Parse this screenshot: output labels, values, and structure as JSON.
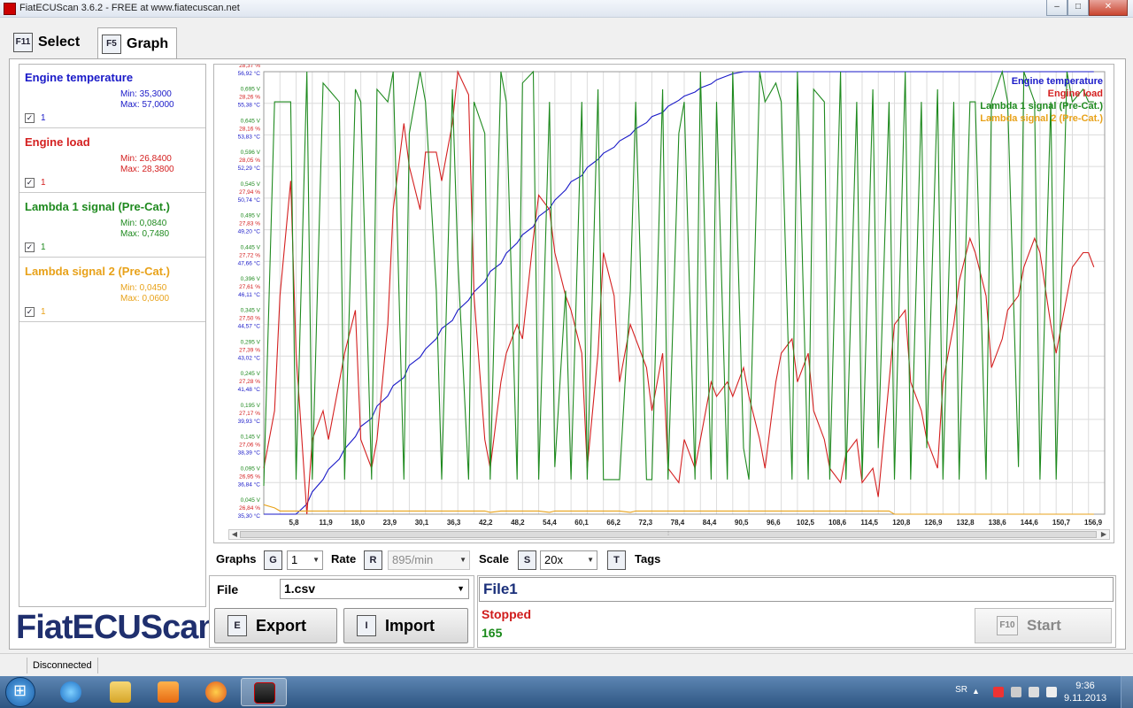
{
  "window": {
    "title": "FiatECUScan 3.6.2 - FREE at www.fiatecuscan.net"
  },
  "tabs": [
    {
      "key": "F11",
      "label": "Select"
    },
    {
      "key": "F5",
      "label": "Graph"
    }
  ],
  "signals": [
    {
      "name": "Engine temperature",
      "min": "Min: 35,3000",
      "max": "Max: 57,0000",
      "check_label": "1",
      "color": "#1a1ac8"
    },
    {
      "name": "Engine load",
      "min": "Min: 26,8400",
      "max": "Max: 28,3800",
      "check_label": "1",
      "color": "#d42020"
    },
    {
      "name": "Lambda 1 signal (Pre-Cat.)",
      "min": "Min: 0,0840",
      "max": "Max: 0,7480",
      "check_label": "1",
      "color": "#1f8a1f"
    },
    {
      "name": "Lambda signal 2 (Pre-Cat.)",
      "min": "Min: 0,0450",
      "max": "Max: 0,0600",
      "check_label": "1",
      "color": "#e8a21a"
    }
  ],
  "logo": "FiatECUScan",
  "controls": {
    "graphs_label": "Graphs",
    "graphs_key": "G",
    "graphs_value": "1",
    "rate_label": "Rate",
    "rate_key": "R",
    "rate_value": "895/min",
    "scale_label": "Scale",
    "scale_key": "S",
    "scale_value": "20x",
    "tags_label": "Tags",
    "tags_key": "T"
  },
  "file": {
    "label": "File",
    "value": "1.csv",
    "export_key": "E",
    "export_label": "Export",
    "import_key": "I",
    "import_label": "Import"
  },
  "session": {
    "name": "File1",
    "status": "Stopped",
    "count": "165",
    "start_key": "F10",
    "start_label": "Start"
  },
  "statusbar": {
    "connection": "Disconnected"
  },
  "taskbar": {
    "language": "SR",
    "time": "9:36",
    "date": "9.11.2013"
  },
  "chart_data": {
    "type": "line",
    "x_ticks": [
      "5,8",
      "11,9",
      "18,0",
      "23,9",
      "30,1",
      "36,3",
      "42,2",
      "48,2",
      "54,4",
      "60,1",
      "66,2",
      "72,3",
      "78,4",
      "84,4",
      "90,5",
      "96,6",
      "102,5",
      "108,6",
      "114,5",
      "120,8",
      "126,9",
      "132,8",
      "138,6",
      "144,6",
      "150,7",
      "156,9"
    ],
    "x": [
      3,
      5,
      6,
      8,
      9,
      11,
      12,
      14,
      15,
      17,
      18,
      20,
      21,
      23,
      24,
      26,
      27,
      29,
      30,
      32,
      33,
      35,
      36,
      38,
      39,
      41,
      42,
      44,
      45,
      47,
      48,
      50,
      51,
      53,
      54,
      56,
      57,
      59,
      60,
      62,
      63,
      65,
      66,
      68,
      69,
      71,
      72,
      74,
      75,
      77,
      78,
      80,
      81,
      83,
      84,
      86,
      87,
      89,
      90,
      92,
      93,
      95,
      96,
      98,
      99,
      101,
      102,
      104,
      105,
      107,
      108,
      110,
      111,
      113,
      114,
      116,
      117,
      119,
      120,
      122,
      123,
      125,
      126,
      128,
      129,
      131,
      132,
      134,
      135,
      137,
      138,
      140,
      141,
      143,
      144,
      146,
      147,
      149,
      150,
      152,
      153,
      155,
      156,
      157
    ],
    "y_axis_labels": [
      {
        "lambda": "",
        "load": "28,37 %",
        "temp": "56,92 °C"
      },
      {
        "lambda": "0,695 V",
        "load": "28,26 %",
        "temp": "55,38 °C"
      },
      {
        "lambda": "0,645 V",
        "load": "28,16 %",
        "temp": "53,83 °C"
      },
      {
        "lambda": "0,596 V",
        "load": "28,05 %",
        "temp": "52,29 °C"
      },
      {
        "lambda": "0,545 V",
        "load": "27,94 %",
        "temp": "50,74 °C"
      },
      {
        "lambda": "0,495 V",
        "load": "27,83 %",
        "temp": "49,20 °C"
      },
      {
        "lambda": "0,445 V",
        "load": "27,72 %",
        "temp": "47,66 °C"
      },
      {
        "lambda": "0,396 V",
        "load": "27,61 %",
        "temp": "46,11 °C"
      },
      {
        "lambda": "0,345 V",
        "load": "27,50 %",
        "temp": "44,57 °C"
      },
      {
        "lambda": "0,295 V",
        "load": "27,39 %",
        "temp": "43,02 °C"
      },
      {
        "lambda": "0,245 V",
        "load": "27,28 %",
        "temp": "41,48 °C"
      },
      {
        "lambda": "0,195 V",
        "load": "27,17 %",
        "temp": "39,93 °C"
      },
      {
        "lambda": "0,145 V",
        "load": "27,06 %",
        "temp": "38,39 °C"
      },
      {
        "lambda": "0,095 V",
        "load": "26,95 %",
        "temp": "36,84 °C"
      },
      {
        "lambda": "0,045 V",
        "load": "26,84 %",
        "temp": "35,30 °C"
      }
    ],
    "series": [
      {
        "name": "Engine temperature",
        "color": "#1a1ac8",
        "values": [
          35.3,
          35.3,
          35.3,
          35.3,
          35.3,
          35.8,
          36.4,
          37.0,
          37.5,
          38.0,
          38.5,
          39.1,
          39.6,
          40.0,
          40.6,
          41.1,
          41.6,
          42.0,
          42.6,
          43.0,
          43.4,
          43.9,
          44.4,
          44.8,
          45.3,
          45.8,
          46.2,
          46.7,
          47.2,
          47.6,
          48.1,
          48.6,
          49.0,
          49.4,
          49.9,
          50.3,
          50.7,
          51.2,
          51.6,
          51.9,
          52.3,
          52.7,
          53.0,
          53.3,
          53.6,
          53.9,
          54.2,
          54.5,
          54.8,
          55.0,
          55.3,
          55.6,
          55.8,
          56.0,
          56.2,
          56.4,
          56.6,
          56.8,
          56.9,
          57.0,
          57.0,
          57.0,
          57.0,
          57.0,
          57.0,
          57.0,
          57.0,
          57.0,
          57.0,
          57.0,
          57.0,
          57.0,
          57.0,
          57.0,
          57.0,
          57.0,
          57.0,
          57.0,
          57.0,
          57.0,
          57.0,
          57.0,
          57.0,
          57.0,
          57.0,
          57.0,
          57.0,
          57.0,
          57.0,
          57.0,
          57.0,
          57.0,
          57.0,
          57.0,
          57.0,
          57.0,
          57.0,
          57.0,
          57.0,
          57.0,
          57.0,
          57.0,
          57.0,
          57.0
        ]
      },
      {
        "name": "Engine load",
        "color": "#d42020",
        "values": [
          27.0,
          27.2,
          27.6,
          28.0,
          27.4,
          26.84,
          27.1,
          27.2,
          27.1,
          27.3,
          27.4,
          27.55,
          27.1,
          27.0,
          27.1,
          27.5,
          27.9,
          28.2,
          28.05,
          27.9,
          28.1,
          28.1,
          28.0,
          28.2,
          28.38,
          28.3,
          27.6,
          27.1,
          27.0,
          27.3,
          27.4,
          27.5,
          27.45,
          27.8,
          27.95,
          27.9,
          27.75,
          27.6,
          27.55,
          27.4,
          27.0,
          27.4,
          27.75,
          27.6,
          27.3,
          27.5,
          27.45,
          27.35,
          27.2,
          27.4,
          27.0,
          26.95,
          27.1,
          27.0,
          27.1,
          27.3,
          27.25,
          27.3,
          27.25,
          27.35,
          27.25,
          27.1,
          27.0,
          27.3,
          27.4,
          27.45,
          27.3,
          27.4,
          27.2,
          27.1,
          27.0,
          26.95,
          27.05,
          27.1,
          26.95,
          27.0,
          26.9,
          27.3,
          27.5,
          27.55,
          27.3,
          27.2,
          27.1,
          27.0,
          27.3,
          27.5,
          27.65,
          27.8,
          27.75,
          27.6,
          27.35,
          27.45,
          27.55,
          27.6,
          27.7,
          27.8,
          27.75,
          27.5,
          27.4,
          27.6,
          27.7,
          27.75,
          27.75,
          27.7
        ]
      },
      {
        "name": "Lambda 1 signal (Pre-Cat.)",
        "color": "#1f8a1f",
        "values": [
          0.09,
          0.7,
          0.7,
          0.7,
          0.1,
          0.75,
          0.1,
          0.73,
          0.72,
          0.7,
          0.1,
          0.72,
          0.7,
          0.1,
          0.72,
          0.7,
          0.75,
          0.1,
          0.65,
          0.75,
          0.7,
          0.4,
          0.1,
          0.72,
          0.45,
          0.1,
          0.7,
          0.65,
          0.1,
          0.75,
          0.7,
          0.1,
          0.73,
          0.75,
          0.1,
          0.7,
          0.12,
          0.4,
          0.1,
          0.7,
          0.1,
          0.72,
          0.1,
          0.1,
          0.1,
          0.4,
          0.7,
          0.1,
          0.1,
          0.72,
          0.1,
          0.65,
          0.7,
          0.1,
          0.75,
          0.1,
          0.7,
          0.1,
          0.75,
          0.15,
          0.1,
          0.75,
          0.7,
          0.73,
          0.7,
          0.1,
          0.75,
          0.1,
          0.72,
          0.7,
          0.1,
          0.75,
          0.1,
          0.7,
          0.1,
          0.72,
          0.15,
          0.7,
          0.1,
          0.75,
          0.1,
          0.7,
          0.15,
          0.72,
          0.1,
          0.7,
          0.1,
          0.7,
          0.7,
          0.1,
          0.7,
          0.75,
          0.7,
          0.12,
          0.75,
          0.7,
          0.1,
          0.7,
          0.1,
          0.75,
          0.7,
          0.72,
          0.7,
          0.7
        ]
      },
      {
        "name": "Lambda signal 2 (Pre-Cat.)",
        "color": "#e8a21a",
        "values": [
          0.06,
          0.055,
          0.05,
          0.05,
          0.05,
          0.05,
          0.05,
          0.05,
          0.05,
          0.05,
          0.05,
          0.05,
          0.05,
          0.05,
          0.05,
          0.05,
          0.05,
          0.05,
          0.05,
          0.05,
          0.05,
          0.05,
          0.05,
          0.05,
          0.05,
          0.05,
          0.05,
          0.05,
          0.048,
          0.05,
          0.05,
          0.05,
          0.05,
          0.05,
          0.05,
          0.048,
          0.05,
          0.05,
          0.05,
          0.05,
          0.05,
          0.05,
          0.05,
          0.05,
          0.05,
          0.048,
          0.05,
          0.05,
          0.05,
          0.05,
          0.05,
          0.05,
          0.05,
          0.05,
          0.05,
          0.05,
          0.05,
          0.05,
          0.05,
          0.05,
          0.05,
          0.05,
          0.05,
          0.05,
          0.05,
          0.05,
          0.05,
          0.05,
          0.05,
          0.05,
          0.05,
          0.05,
          0.05,
          0.05,
          0.05,
          0.05,
          0.05,
          0.05,
          0.045,
          0.045,
          0.045,
          0.045,
          0.045,
          0.045,
          0.045,
          0.045,
          0.045,
          0.045,
          0.045,
          0.045,
          0.045,
          0.045,
          0.045,
          0.045,
          0.045,
          0.045,
          0.045,
          0.045,
          0.045,
          0.045,
          0.045,
          0.045,
          0.045,
          0.045
        ]
      }
    ],
    "ranges": {
      "x": [
        3,
        159
      ],
      "temp": [
        35.3,
        57.0
      ],
      "load": [
        26.84,
        28.38
      ],
      "lambda": [
        0.045,
        0.748
      ],
      "lambda2": [
        0.045,
        0.06
      ]
    },
    "grid": true,
    "legend": "top-right"
  }
}
